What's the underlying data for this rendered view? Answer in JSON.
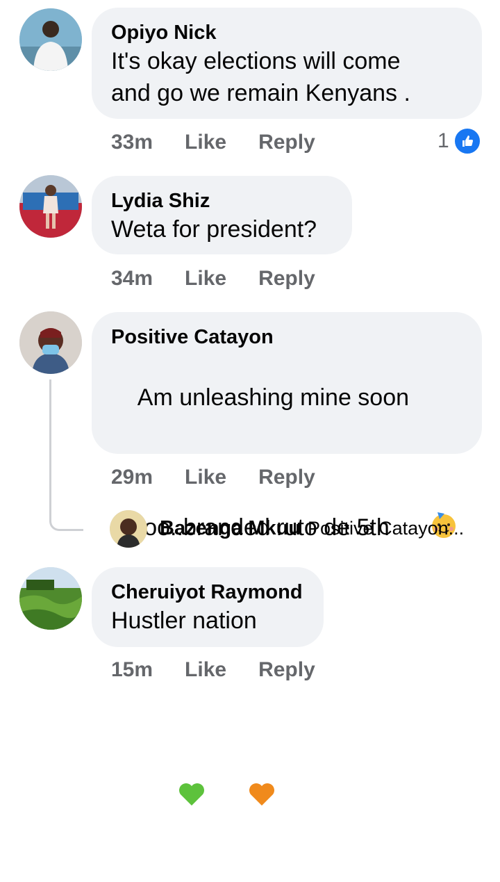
{
  "comments": [
    {
      "author": "Opiyo Nick",
      "text": "It's okay elections will come\nand go we remain Kenyans .",
      "time": "33m",
      "like_label": "Like",
      "reply_label": "Reply",
      "reaction_count": "1",
      "reaction_icon": "thumbs-up-icon"
    },
    {
      "author": "Lydia Shiz",
      "text": "Weta for president?",
      "time": "34m",
      "like_label": "Like",
      "reply_label": "Reply"
    },
    {
      "author": "Positive Catayon",
      "text_line1": "Am unleashing mine soon",
      "text_line2": "too..branded ruto de 5th",
      "time": "29m",
      "like_label": "Like",
      "reply_label": "Reply",
      "reply_preview": {
        "author": "Bazenga Mkuu",
        "text": "Positive Catayon..."
      }
    },
    {
      "author": "Cheruiyot Raymond",
      "text": "Hustler nation",
      "time": "15m",
      "like_label": "Like",
      "reply_label": "Reply"
    }
  ],
  "colors": {
    "bubble": "#f0f2f5",
    "secondary_text": "#65676b",
    "like_blue": "#1877f2"
  }
}
